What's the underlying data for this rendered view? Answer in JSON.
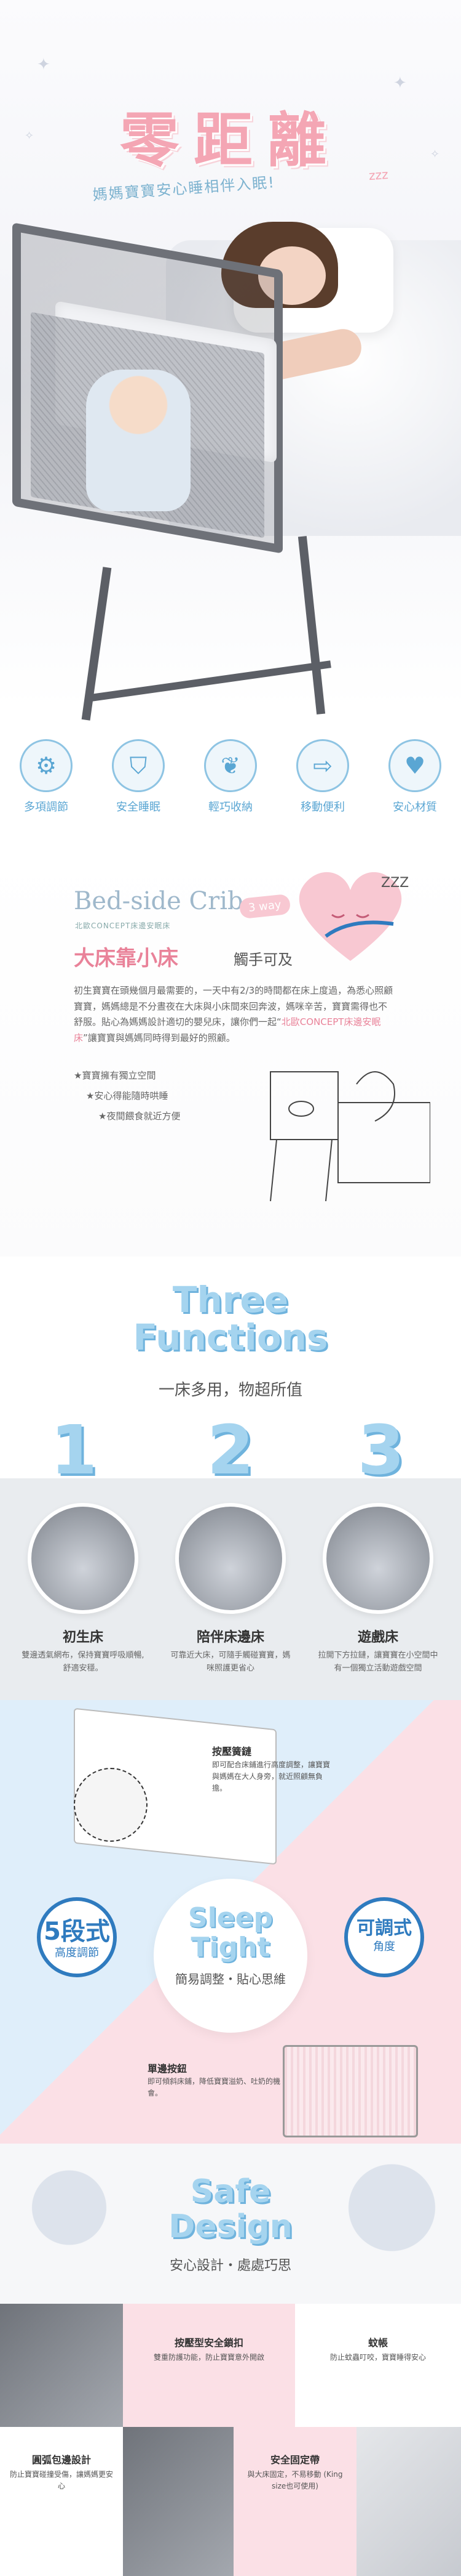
{
  "hero": {
    "title": "零距離",
    "subtitle": "媽媽寶寶安心睡相伴入眠!",
    "zz": "zzz"
  },
  "features": [
    {
      "icon": "gear-icon",
      "glyph": "⚙",
      "label": "多項調節"
    },
    {
      "icon": "shield-icon",
      "glyph": "⛉",
      "label": "安全睡眠"
    },
    {
      "icon": "feather-icon",
      "glyph": "❦",
      "label": "輕巧收納"
    },
    {
      "icon": "move-arrows-icon",
      "glyph": "⇨",
      "label": "移動便利"
    },
    {
      "icon": "heart-icon",
      "glyph": "♥",
      "label": "安心材質"
    }
  ],
  "bedside": {
    "title": "Bed-side Crib",
    "mini": "北歐CONCEPT床邊安眠床",
    "way": "3 way",
    "zz": "ZZZ",
    "heading": "大床靠小床",
    "heading_sub": "觸手可及",
    "body_pre": "初生寶寶在頭幾個月最需要的，一天中有2/3的時間都在床上度過，為悉心照顧寶寶，媽媽總是不分晝夜在大床與小床間來回奔波，媽咪辛苦，寶寶需得也不舒服。貼心為媽媽設計適切的嬰兒床，讓你們一起",
    "body_hl": "北歐CONCEPT床邊安眠床",
    "body_post": "讓寶寶與媽媽同時得到最好的照顧。",
    "bullets": [
      "★寶寶擁有獨立空間",
      "★安心得能隨時哄睡",
      "★夜間餵食就近方便"
    ]
  },
  "three": {
    "title_line1": "Three",
    "title_line2": "Functions",
    "subtitle": "一床多用，物超所值",
    "items": [
      {
        "num": "1",
        "title": "初生床",
        "desc": "雙邊透氣網布，保持寶寶呼吸順暢,舒適安穩。"
      },
      {
        "num": "2",
        "title": "陪伴床邊床",
        "desc": "可靠近大床，可隨手觸碰寶寶，媽咪照護更省心"
      },
      {
        "num": "3",
        "title": "遊戲床",
        "desc": "拉開下方拉鏈，讓寶寶在小空間中有一個獨立活動遊戲空間"
      }
    ]
  },
  "sleep": {
    "note1_title": "按壓簧鏈",
    "note1_body": "即可配合床鋪進行高度調整，讓寶寶與媽媽在大人身旁，就近照顧無負擔。",
    "badge_left_big": "5段式",
    "badge_left_small": "高度調節",
    "st_line1": "Sleep",
    "st_line2": "Tight",
    "st_sub": "簡易調整・貼心思維",
    "badge_right_big": "可調式",
    "badge_right_small": "角度",
    "note2_title": "單邊按鈕",
    "note2_body": "即可傾斜床鋪，降低寶寶溢奶、吐奶的機會。"
  },
  "safe": {
    "title_line1": "Safe",
    "title_line2": "Design",
    "subtitle": "安心設計・處處巧思",
    "items": [
      {
        "title": "按壓型安全鎖扣",
        "desc": "雙重防護功能，防止寶寶意外開啟"
      },
      {
        "title": "蚊帳",
        "desc": "防止蚊蟲叮咬，寶寶睡得安心"
      },
      {
        "title": "圓弧包邊設計",
        "desc": "防止寶寶碰撞受傷，讓媽媽更安心"
      },
      {
        "title": "安全固定帶",
        "desc": "與大床固定，不易移動 (King size也可使用)"
      }
    ]
  }
}
